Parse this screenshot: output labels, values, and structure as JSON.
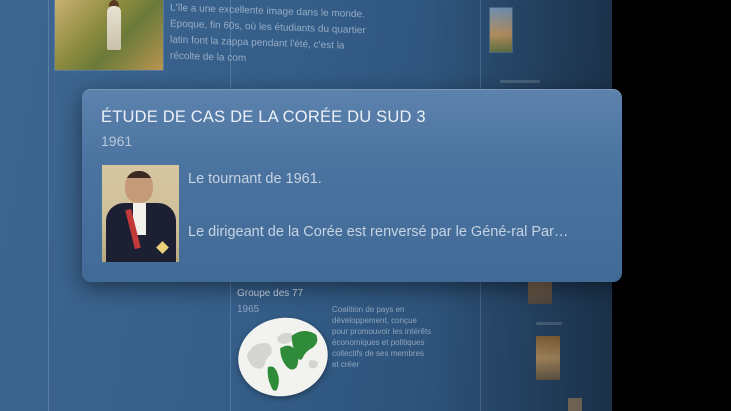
{
  "background": {
    "article_text": "L'île a une excellente image dans le monde. Epoque, fin 60s, où les étudiants du quartier latin font la zappa pendant l'été, c'est la récolte de la com",
    "group_title": "Groupe des 77",
    "group_year": "1965",
    "group_text": "Coalition de pays en développement, conçue pour promouvoir les intérêts économiques et politiques collectifs de ses membres et créer"
  },
  "card": {
    "title": "ÉTUDE DE CAS DE LA CORÉE DU SUD 3",
    "year": "1961",
    "line1": "Le tournant de 1961.",
    "line2": "Le dirigeant de la Corée est renversé par le Géné-ral Par…"
  },
  "colors": {
    "card_bg": "#4b739f",
    "wall_bg": "#345d88",
    "title_text": "#ecf1f7",
    "body_text": "#c6d4e4"
  },
  "icons": {
    "globe": "world-map-icon",
    "portrait": "portrait-photo"
  }
}
